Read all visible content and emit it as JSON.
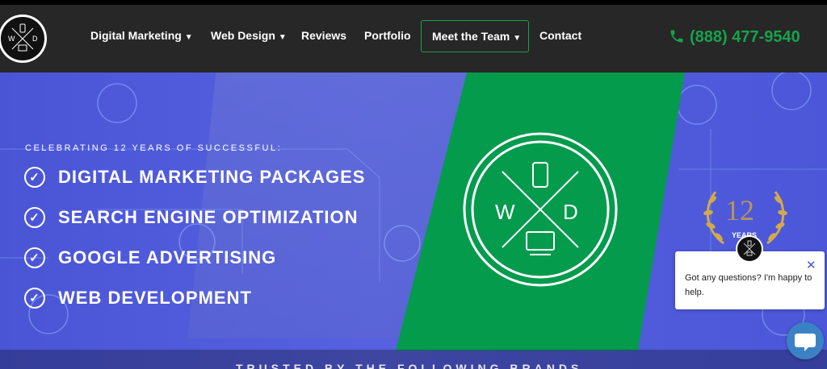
{
  "nav": {
    "logo_letters": {
      "left": "W",
      "right": "D"
    },
    "items": [
      {
        "label": "Digital Marketing",
        "has_dropdown": true
      },
      {
        "label": "Web Design",
        "has_dropdown": true
      },
      {
        "label": "Reviews",
        "has_dropdown": false
      },
      {
        "label": "Portfolio",
        "has_dropdown": false
      },
      {
        "label": "Meet the Team",
        "has_dropdown": true
      },
      {
        "label": "Contact",
        "has_dropdown": false
      }
    ],
    "phone": "(888) 477-9540",
    "caret_icon": "chevron-down-icon",
    "phone_icon": "phone-icon"
  },
  "hero": {
    "tagline": "CELEBRATING 12 YEARS OF SUCCESSFUL:",
    "items": [
      "DIGITAL MARKETING PACKAGES",
      "SEARCH ENGINE OPTIMIZATION",
      "GOOGLE ADVERTISING",
      "WEB DEVELOPMENT"
    ],
    "badge": {
      "number": "12",
      "label": "YEARS"
    },
    "emblem_letters": {
      "left": "W",
      "right": "D"
    },
    "brands_text": "TRUSTED BY THE FOLLOWING BRANDS"
  },
  "chat": {
    "message": "Got any questions? I'm happy to help.",
    "close_icon": "close-icon",
    "button_icon": "chat-bubble-icon"
  },
  "colors": {
    "accent": "#16a34a",
    "hero_bg": "#4f5ad9",
    "nav_bg": "#272727",
    "chat_button": "#3b82c4"
  }
}
